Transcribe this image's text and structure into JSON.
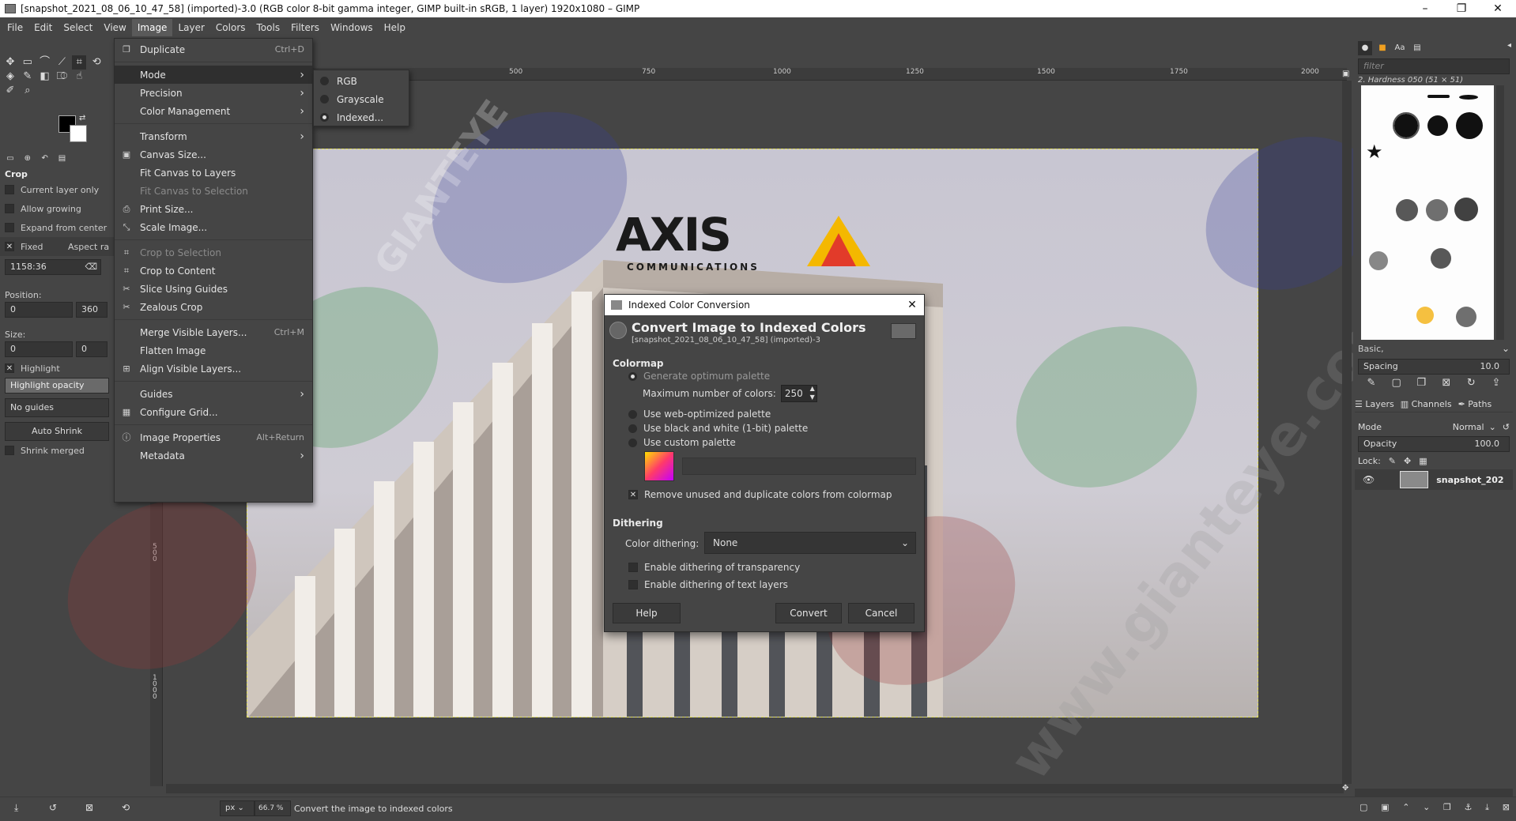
{
  "window": {
    "title": "[snapshot_2021_08_06_10_47_58] (imported)-3.0 (RGB color 8-bit gamma integer, GIMP built-in sRGB, 1 layer) 1920x1080 – GIMP",
    "minimize": "–",
    "maximize": "❐",
    "close": "✕"
  },
  "menubar": [
    "File",
    "Edit",
    "Select",
    "View",
    "Image",
    "Layer",
    "Colors",
    "Tools",
    "Filters",
    "Windows",
    "Help"
  ],
  "toolbox": {
    "tool_title": "Crop",
    "current_layer_only": "Current layer only",
    "allow_growing": "Allow growing",
    "expand_from_center": "Expand from center",
    "fixed": "Fixed",
    "aspect_ratio": "Aspect ra",
    "ratio_value": "1158:36",
    "position_label": "Position:",
    "position_x": "0",
    "position_y": "360",
    "size_label": "Size:",
    "size_w": "0",
    "size_h": "0",
    "highlight": "Highlight",
    "highlight_opacity": "Highlight opacity",
    "guides": "No guides",
    "auto_shrink": "Auto Shrink",
    "shrink_merged": "Shrink merged"
  },
  "image_menu": {
    "items": [
      {
        "icon": "duplicate-icon",
        "glyph": "❐",
        "label": "Duplicate",
        "accel": "Ctrl+D"
      },
      {
        "sep": true
      },
      {
        "label": "Mode",
        "submenu": true,
        "highlight": true
      },
      {
        "label": "Precision",
        "submenu": true
      },
      {
        "label": "Color Management",
        "submenu": true
      },
      {
        "sep": true
      },
      {
        "label": "Transform",
        "submenu": true
      },
      {
        "icon": "canvas-size-icon",
        "glyph": "▣",
        "label": "Canvas Size..."
      },
      {
        "label": "Fit Canvas to Layers"
      },
      {
        "label": "Fit Canvas to Selection",
        "disabled": true
      },
      {
        "icon": "print-size-icon",
        "glyph": "⎙",
        "label": "Print Size..."
      },
      {
        "icon": "scale-image-icon",
        "glyph": "⤡",
        "label": "Scale Image..."
      },
      {
        "sep": true
      },
      {
        "icon": "crop-to-selection-icon",
        "glyph": "⌗",
        "label": "Crop to Selection",
        "disabled": true
      },
      {
        "icon": "crop-to-content-icon",
        "glyph": "⌗",
        "label": "Crop to Content"
      },
      {
        "icon": "slice-guides-icon",
        "glyph": "✂",
        "label": "Slice Using Guides"
      },
      {
        "label": "Zealous Crop"
      },
      {
        "sep": true
      },
      {
        "label": "Merge Visible Layers...",
        "accel": "Ctrl+M"
      },
      {
        "label": "Flatten Image"
      },
      {
        "icon": "align-layers-icon",
        "glyph": "⊞",
        "label": "Align Visible Layers..."
      },
      {
        "sep": true
      },
      {
        "label": "Guides",
        "submenu": true
      },
      {
        "icon": "grid-icon",
        "glyph": "▦",
        "label": "Configure Grid..."
      },
      {
        "sep": true
      },
      {
        "icon": "info-icon",
        "glyph": "ⓘ",
        "label": "Image Properties",
        "accel": "Alt+Return"
      },
      {
        "label": "Metadata",
        "submenu": true
      }
    ]
  },
  "mode_submenu": {
    "items": [
      {
        "label": "RGB",
        "selected": false
      },
      {
        "label": "Grayscale",
        "selected": false
      },
      {
        "label": "Indexed...",
        "selected": true
      }
    ]
  },
  "ruler": {
    "h_ticks": [
      "500",
      "750",
      "1000",
      "1250",
      "1500",
      "1750",
      "2000"
    ],
    "v_ticks": [
      "5 0 0",
      "1 0 0 0"
    ]
  },
  "dialog": {
    "title": "Indexed Color Conversion",
    "heading": "Convert Image to Indexed Colors",
    "subheading": "[snapshot_2021_08_06_10_47_58] (imported)-3",
    "colormap_header": "Colormap",
    "optimum": "Generate optimum palette",
    "max_colors_label": "Maximum number of colors:",
    "max_colors": "250",
    "web": "Use web-optimized palette",
    "bw": "Use black and white (1-bit) palette",
    "custom": "Use custom palette",
    "remove_unused": "Remove unused and duplicate colors from colormap",
    "dithering_header": "Dithering",
    "color_dithering_label": "Color dithering:",
    "color_dithering_value": "None",
    "dither_transparency": "Enable dithering of transparency",
    "dither_text": "Enable dithering of text layers",
    "help": "Help",
    "convert": "Convert",
    "cancel": "Cancel"
  },
  "image": {
    "logo": "AXIS",
    "logo_sub": "COMMUNICATIONS"
  },
  "right_panel": {
    "filter_placeholder": "filter",
    "brush_name": "2. Hardness 050 (51 × 51)",
    "preset": "Basic,",
    "spacing_label": "Spacing",
    "spacing_value": "10.0",
    "tabs": [
      "Layers",
      "Channels",
      "Paths"
    ],
    "mode_label": "Mode",
    "mode_value": "Normal",
    "opacity_label": "Opacity",
    "opacity_value": "100.0",
    "lock_label": "Lock:",
    "layer_name": "snapshot_202"
  },
  "statusbar": {
    "unit": "px",
    "zoom": "66.7 %",
    "message": "Convert the image to indexed colors"
  },
  "watermark": {
    "text": "GIANTEYE",
    "url": "www.gianteye.com"
  },
  "colors": {
    "accent_yellow": "#f4b800",
    "accent_red": "#e23b2a",
    "fg": "#000000",
    "bg": "#ffffff"
  }
}
